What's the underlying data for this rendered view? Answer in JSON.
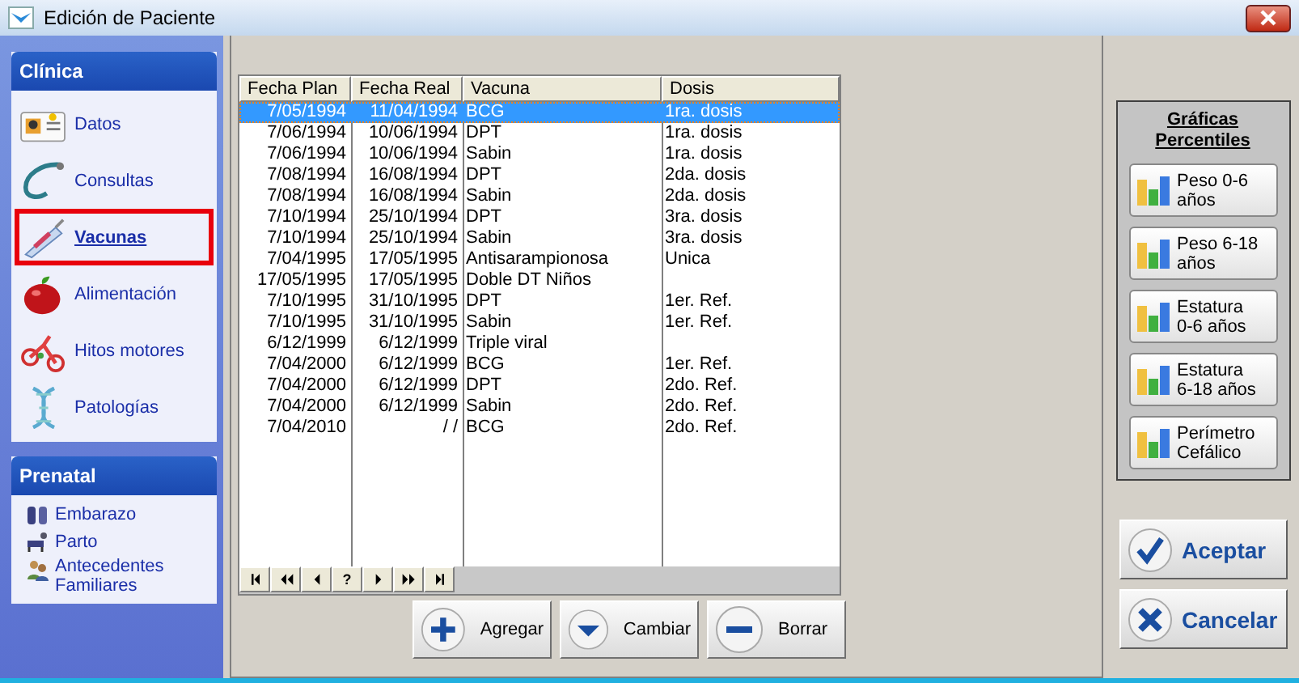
{
  "window": {
    "title": "Edición de Paciente"
  },
  "sidebar": {
    "sections": [
      {
        "title": "Clínica",
        "items": [
          {
            "label": "Datos",
            "selected": false
          },
          {
            "label": "Consultas",
            "selected": false
          },
          {
            "label": "Vacunas",
            "selected": true
          },
          {
            "label": "Alimentación",
            "selected": false
          },
          {
            "label": "Hitos motores",
            "selected": false
          },
          {
            "label": "Patologías",
            "selected": false
          }
        ]
      },
      {
        "title": "Prenatal",
        "items": [
          {
            "label": "Embarazo",
            "selected": false
          },
          {
            "label": "Parto",
            "selected": false
          },
          {
            "label": "Antecedentes Familiares",
            "selected": false
          }
        ]
      }
    ]
  },
  "table": {
    "columns": [
      "Fecha Plan",
      "Fecha Real",
      "Vacuna",
      "Dosis"
    ],
    "rows": [
      {
        "cells": [
          "7/05/1994",
          "11/04/1994",
          "BCG",
          "1ra. dosis"
        ],
        "selected": true
      },
      {
        "cells": [
          "7/06/1994",
          "10/06/1994",
          "DPT",
          "1ra. dosis"
        ],
        "selected": false
      },
      {
        "cells": [
          "7/06/1994",
          "10/06/1994",
          "Sabin",
          "1ra. dosis"
        ],
        "selected": false
      },
      {
        "cells": [
          "7/08/1994",
          "16/08/1994",
          "DPT",
          "2da. dosis"
        ],
        "selected": false
      },
      {
        "cells": [
          "7/08/1994",
          "16/08/1994",
          "Sabin",
          "2da. dosis"
        ],
        "selected": false
      },
      {
        "cells": [
          "7/10/1994",
          "25/10/1994",
          "DPT",
          "3ra. dosis"
        ],
        "selected": false
      },
      {
        "cells": [
          "7/10/1994",
          "25/10/1994",
          "Sabin",
          "3ra. dosis"
        ],
        "selected": false
      },
      {
        "cells": [
          "7/04/1995",
          "17/05/1995",
          "Antisarampionosa",
          "Unica"
        ],
        "selected": false
      },
      {
        "cells": [
          "17/05/1995",
          "17/05/1995",
          "Doble DT Niños"
        ],
        "selected": false
      },
      {
        "cells": [
          "7/10/1995",
          "31/10/1995",
          "DPT",
          "1er. Ref."
        ],
        "selected": false
      },
      {
        "cells": [
          "7/10/1995",
          "31/10/1995",
          "Sabin",
          "1er. Ref."
        ],
        "selected": false
      },
      {
        "cells": [
          "6/12/1999",
          "6/12/1999",
          "Triple viral"
        ],
        "selected": false
      },
      {
        "cells": [
          "7/04/2000",
          "6/12/1999",
          "BCG",
          "1er. Ref."
        ],
        "selected": false
      },
      {
        "cells": [
          "7/04/2000",
          "6/12/1999",
          "DPT",
          "2do. Ref."
        ],
        "selected": false
      },
      {
        "cells": [
          "7/04/2000",
          "6/12/1999",
          "Sabin",
          "2do. Ref."
        ],
        "selected": false
      },
      {
        "cells": [
          "7/04/2010",
          "/  /",
          "BCG",
          "2do. Ref."
        ],
        "selected": false
      }
    ],
    "navigator": [
      {
        "kind": "first"
      },
      {
        "kind": "prior-page"
      },
      {
        "kind": "prior"
      },
      {
        "kind": "text",
        "label": "?"
      },
      {
        "kind": "next"
      },
      {
        "kind": "next-page"
      },
      {
        "kind": "last"
      }
    ]
  },
  "actions": [
    "Agregar",
    "Cambiar",
    "Borrar"
  ],
  "charts_panel": {
    "title": "Gráficas Percentiles",
    "buttons": [
      "Peso 0-6 años",
      "Peso 6-18 años",
      "Estatura 0-6 años",
      "Estatura 6-18 años",
      "Perímetro Cefálico"
    ]
  },
  "dialog_buttons": [
    "Aceptar",
    "Cancelar"
  ]
}
